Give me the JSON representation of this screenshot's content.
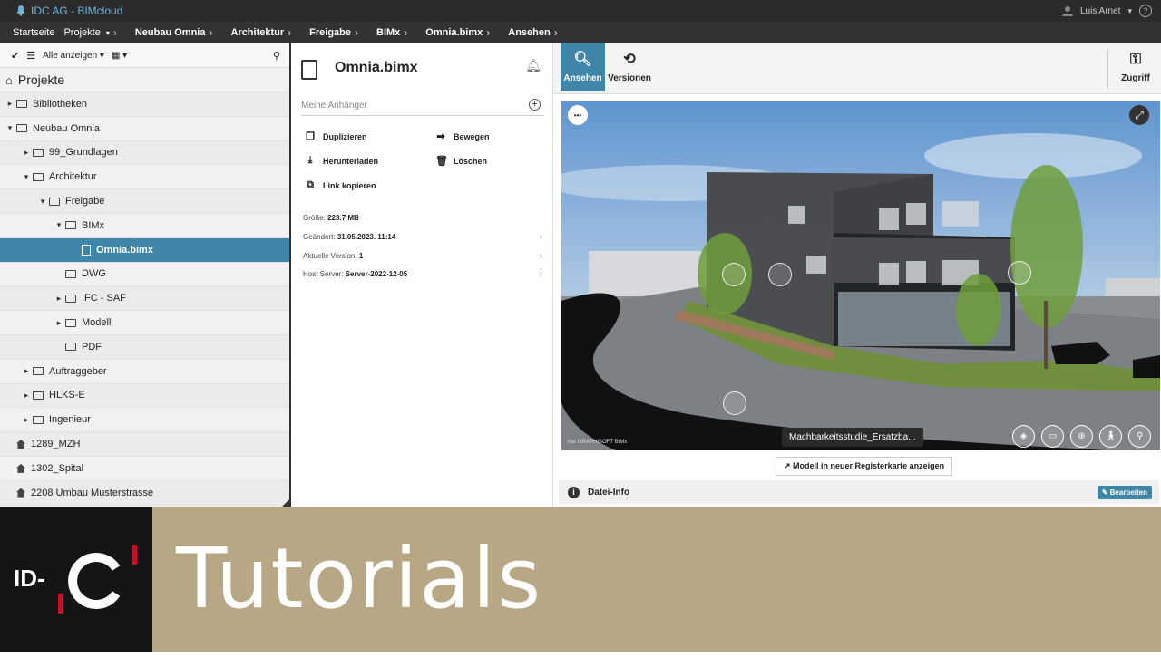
{
  "topbar": {
    "app_title": "IDC AG - BIMcloud",
    "user_name": "Luis Arnet",
    "user_caret": "▾",
    "help_icon": "help-icon",
    "colors": {
      "accent": "#3f86a8",
      "brand": "#6cb4dc"
    }
  },
  "breadcrumbs": [
    "Startseite",
    "Projekte",
    "Neubau Omnia",
    "Architektur",
    "Freigabe",
    "BIMx",
    "Omnia.bimx",
    "Ansehen"
  ],
  "left_panel": {
    "filter_label": "Alle anzeigen",
    "title": "Projekte",
    "tree": [
      {
        "label": "Bibliotheken",
        "caret": "▸"
      },
      {
        "label": "Neubau Omnia",
        "caret": "▾"
      },
      {
        "label": "99_Grundlagen",
        "caret": "▸"
      },
      {
        "label": "Architektur",
        "caret": "▾"
      },
      {
        "label": "Freigabe",
        "caret": "▾"
      },
      {
        "label": "BIMx",
        "caret": "▾"
      },
      {
        "label": "Omnia.bimx",
        "caret": ""
      },
      {
        "label": "DWG",
        "caret": ""
      },
      {
        "label": "IFC - SAF",
        "caret": "▸"
      },
      {
        "label": "Modell",
        "caret": "▸"
      },
      {
        "label": "PDF",
        "caret": ""
      },
      {
        "label": "Auftraggeber",
        "caret": "▸"
      },
      {
        "label": "HLKS-E",
        "caret": "▸"
      },
      {
        "label": "Ingenieur",
        "caret": "▸"
      },
      {
        "label": "1289_MZH",
        "caret": ""
      },
      {
        "label": "1302_Spital",
        "caret": ""
      },
      {
        "label": "2208 Umbau Musterstrasse",
        "caret": ""
      }
    ]
  },
  "middle_panel": {
    "title": "Omnia.bimx",
    "attachments_placeholder": "Meine Anhänger",
    "actions": {
      "duplicate": "Duplizieren",
      "move": "Bewegen",
      "download": "Herunterladen",
      "delete": "Löschen",
      "copy_link": "Link kopieren"
    },
    "info": {
      "size_label": "Größe:",
      "size_value": "223.7 MB",
      "changed_label": "Geändert:",
      "changed_value": "31.05.2023. 11:14",
      "version_label": "Aktuelle Version:",
      "version_value": "1",
      "host_label": "Host Server:",
      "host_value": "Server-2022-12-05"
    }
  },
  "right_panel": {
    "tab_view": "Ansehen",
    "tab_versions": "Versionen",
    "tab_access": "Zugriff",
    "viewer": {
      "caption": "Machbarkeitsstudie_Ersatzba...",
      "credit": "Von GRAPHISOFT BIMx",
      "menu_glyph": "•••"
    },
    "open_link": "Modell in neuer Registerkarte anzeigen",
    "file_info": "Datei-Info",
    "edit_button": "Bearbeiten"
  },
  "banner": {
    "text": "Tutorials",
    "logo_text": "ID-"
  }
}
